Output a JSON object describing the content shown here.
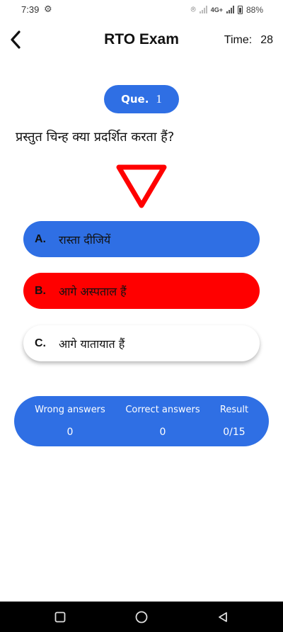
{
  "status_bar": {
    "time": "7:39",
    "network": "4G+",
    "battery": "88%"
  },
  "header": {
    "title": "RTO Exam",
    "timer_label": "Time:",
    "timer_value": "28"
  },
  "question": {
    "badge_label": "Que.",
    "number": "1",
    "text": "प्रस्तुत चिन्ह क्या प्रदर्शित करता हैं?"
  },
  "sign": {
    "type": "yield-triangle",
    "color": "#ff0000"
  },
  "options": [
    {
      "letter": "A.",
      "text": "रास्ता दीजियें",
      "color": "#2f6fe4"
    },
    {
      "letter": "B.",
      "text": "आगे अस्पताल हैं",
      "color": "#ff0000"
    },
    {
      "letter": "C.",
      "text": "आगे यातायात हैं",
      "color": "#ffffff"
    }
  ],
  "stats": {
    "wrong_label": "Wrong answers",
    "wrong_value": "0",
    "correct_label": "Correct answers",
    "correct_value": "0",
    "result_label": "Result",
    "result_value": "0/15"
  },
  "colors": {
    "accent": "#2f6fe4",
    "wrong": "#ff0000"
  },
  "icons": [
    "back-arrow-icon",
    "settings-gear-icon",
    "recents-square-icon",
    "home-circle-icon",
    "back-triangle-icon"
  ]
}
